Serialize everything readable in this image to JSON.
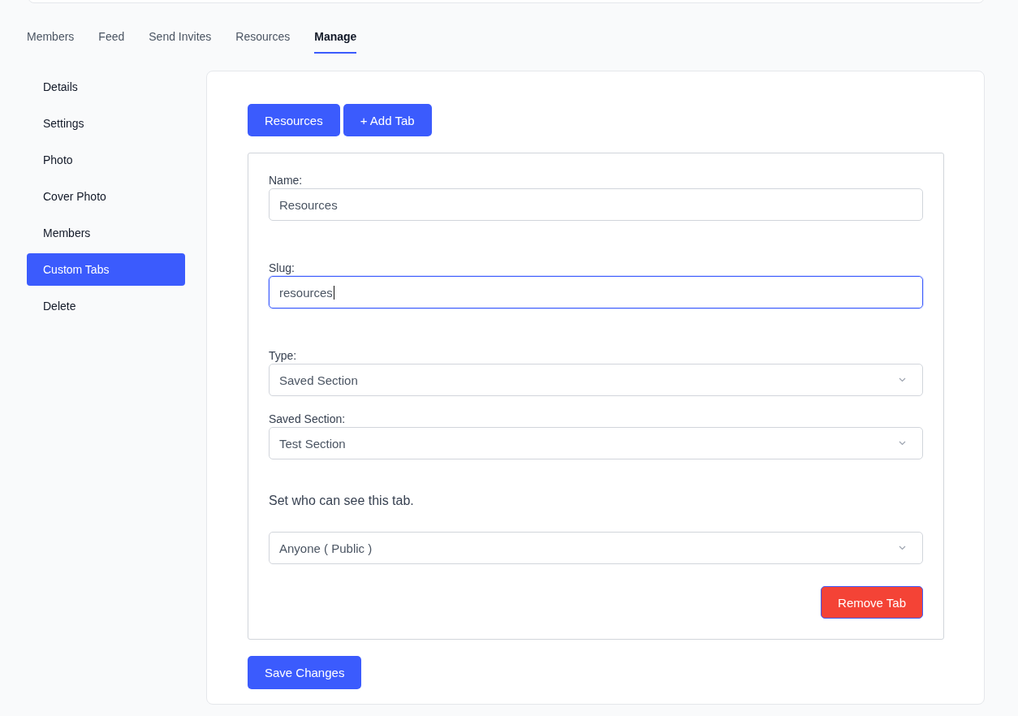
{
  "tabs": [
    {
      "label": "Members",
      "selected": false
    },
    {
      "label": "Feed",
      "selected": false
    },
    {
      "label": "Send Invites",
      "selected": false
    },
    {
      "label": "Resources",
      "selected": false
    },
    {
      "label": "Manage",
      "selected": true
    }
  ],
  "sidebar": {
    "items": [
      {
        "label": "Details",
        "selected": false
      },
      {
        "label": "Settings",
        "selected": false
      },
      {
        "label": "Photo",
        "selected": false
      },
      {
        "label": "Cover Photo",
        "selected": false
      },
      {
        "label": "Members",
        "selected": false
      },
      {
        "label": "Custom Tabs",
        "selected": true
      },
      {
        "label": "Delete",
        "selected": false
      }
    ]
  },
  "tab_buttons": [
    {
      "label": "Resources"
    },
    {
      "label": "+ Add Tab"
    }
  ],
  "form": {
    "fields": [
      {
        "kind": "text",
        "label": "Name:",
        "value": "Resources",
        "focused": false
      },
      {
        "kind": "text",
        "label": "Slug:",
        "value": "resources",
        "focused": true
      },
      {
        "kind": "select",
        "label": "Type:",
        "value": "Saved Section",
        "focused": false
      },
      {
        "kind": "select",
        "label": "Saved Section:",
        "value": "Test Section",
        "focused": false
      },
      {
        "kind": "note",
        "text": "Set who can see this tab."
      },
      {
        "kind": "select",
        "value": "Anyone ( Public )",
        "focused": false
      }
    ],
    "remove_button": "Remove Tab"
  },
  "save_button": "Save Changes"
}
